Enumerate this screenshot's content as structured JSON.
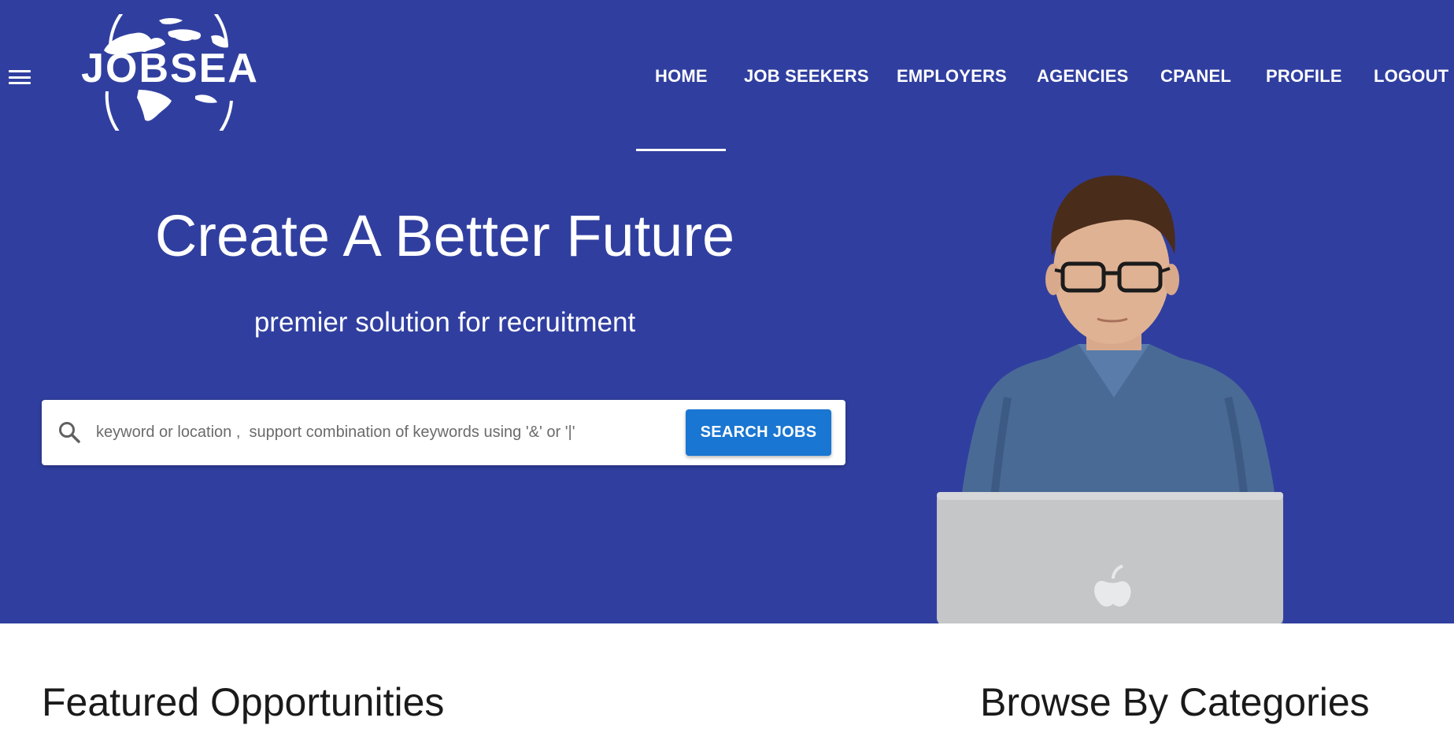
{
  "header": {
    "logo_text": "JOBSEA",
    "menu_icon": "hamburger-menu-icon"
  },
  "nav": {
    "items": [
      {
        "label": "HOME",
        "active": true
      },
      {
        "label": "JOB SEEKERS",
        "active": false
      },
      {
        "label": "EMPLOYERS",
        "active": false
      },
      {
        "label": "AGENCIES",
        "active": false
      },
      {
        "label": "CPANEL",
        "active": false
      },
      {
        "label": "PROFILE",
        "active": false
      },
      {
        "label": "LOGOUT",
        "active": false
      }
    ]
  },
  "hero": {
    "title": "Create A Better Future",
    "subtitle": "premier solution for recruitment",
    "image": "man-with-laptop-photo",
    "background_color": "#303f9f"
  },
  "search": {
    "placeholder": "keyword or location ,  support combination of keywords using '&' or '|'",
    "value": "",
    "icon": "search-icon",
    "button_label": "SEARCH JOBS",
    "button_color": "#1976d2"
  },
  "sections": {
    "featured_title": "Featured Opportunities",
    "categories_title": "Browse By Categories"
  }
}
